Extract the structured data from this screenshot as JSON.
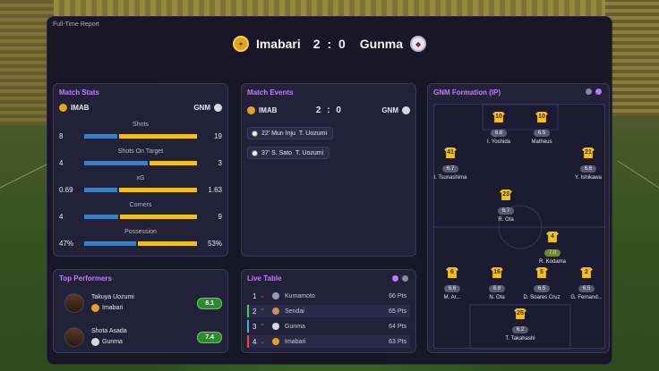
{
  "report_title": "Full-Time Report",
  "header": {
    "home_team": "Imabari",
    "away_team": "Gunma",
    "score": "2 : 0"
  },
  "stats": {
    "title": "Match Stats",
    "home_abbr": "IMAB",
    "away_abbr": "GNM",
    "rows": [
      {
        "label": "Shots",
        "home": "8",
        "away": "19",
        "home_frac": 0.3
      },
      {
        "label": "Shots On Target",
        "home": "4",
        "away": "3",
        "home_frac": 0.57
      },
      {
        "label": "xG",
        "home": "0.69",
        "away": "1.63",
        "home_frac": 0.3
      },
      {
        "label": "Corners",
        "home": "4",
        "away": "9",
        "home_frac": 0.31
      },
      {
        "label": "Possession",
        "home": "47%",
        "away": "53%",
        "home_frac": 0.47
      }
    ]
  },
  "events": {
    "title": "Match Events",
    "home_abbr": "IMAB",
    "away_abbr": "GNM",
    "score": "2 : 0",
    "items": [
      {
        "text": "22' Mun Inju",
        "assist": "T. Uozumi"
      },
      {
        "text": "37' S. Sato",
        "assist": "T. Uozumi"
      }
    ]
  },
  "formation": {
    "title": "GNM Formation (IP)",
    "players": [
      {
        "num": "10",
        "rating": "6.8",
        "name": "I. Yoshida"
      },
      {
        "num": "10",
        "rating": "6.5",
        "name": "Matheus"
      },
      {
        "num": "41",
        "rating": "6.7",
        "name": "I. Tsunashima"
      },
      {
        "num": "21",
        "rating": "6.6",
        "name": "Y. Ishikawa"
      },
      {
        "num": "23",
        "rating": "6.7",
        "name": "R. Ota"
      },
      {
        "num": "4",
        "rating": "7.0",
        "name": "R. Kodama"
      },
      {
        "num": "6",
        "rating": "6.6",
        "name": "M. Ar..."
      },
      {
        "num": "16",
        "rating": "6.8",
        "name": "N. Ota"
      },
      {
        "num": "5",
        "rating": "6.5",
        "name": "D. Soares Cruz"
      },
      {
        "num": "2",
        "rating": "6.5",
        "name": "G. Fernand..."
      },
      {
        "num": "25",
        "rating": "6.2",
        "name": "T. Takahashi"
      }
    ]
  },
  "performers": {
    "title": "Top Performers",
    "items": [
      {
        "name": "Takuya Uozumi",
        "club": "Imabari",
        "rating": "8.1"
      },
      {
        "name": "Shota Asada",
        "club": "Gunma",
        "rating": "7.4"
      }
    ]
  },
  "live_table": {
    "title": "Live Table",
    "rows": [
      {
        "pos": "1",
        "arrow": "⌄",
        "dir": "down",
        "team": "Kumamoto",
        "pts": "66 Pts"
      },
      {
        "pos": "2",
        "arrow": "⌃",
        "dir": "up",
        "team": "Sendai",
        "pts": "65 Pts"
      },
      {
        "pos": "3",
        "arrow": "⌃",
        "dir": "up",
        "team": "Gunma",
        "pts": "64 Pts"
      },
      {
        "pos": "4",
        "arrow": "⌄",
        "dir": "down",
        "team": "Imabari",
        "pts": "63 Pts"
      }
    ]
  },
  "colors": {
    "accent": "#c37cff",
    "home_bar": "#3d7fc2",
    "away_bar": "#f2c019",
    "shirt": "#f2c019"
  }
}
